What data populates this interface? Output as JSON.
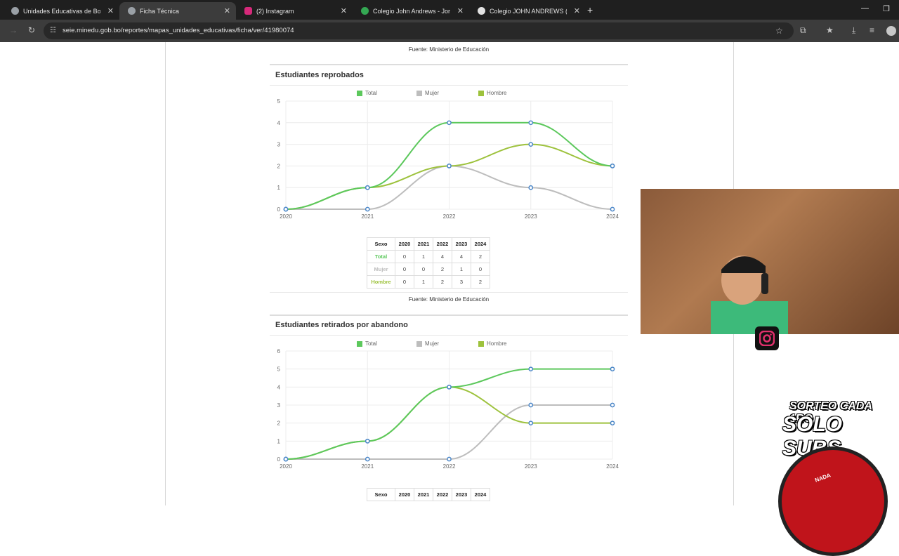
{
  "browser": {
    "tabs": [
      {
        "label": "Unidades Educativas de Bolivia",
        "icon": "globe-icon",
        "active": false
      },
      {
        "label": "Ficha Técnica",
        "icon": "globe-icon",
        "active": true
      },
      {
        "label": "(2) Instagram",
        "icon": "instagram-icon",
        "active": false
      },
      {
        "label": "Colegio John Andrews - Joroch",
        "icon": "maps-pin-icon",
        "active": false
      },
      {
        "label": "Colegio JOHN ANDREWS (@co",
        "icon": "tiktok-icon",
        "active": false
      }
    ],
    "new_tab": "+",
    "url": "seie.minedu.gob.bo/reportes/mapas_unidades_educativas/ficha/ver/41980074"
  },
  "sections": {
    "fuente_label": "Fuente: Ministerio de Educación",
    "reprobados": {
      "title": "Estudiantes reprobados",
      "legend": [
        "Total",
        "Mujer",
        "Hombre"
      ],
      "table_header": [
        "Sexo",
        "2020",
        "2021",
        "2022",
        "2023",
        "2024"
      ],
      "rows": [
        {
          "label": "Total",
          "values": [
            "0",
            "1",
            "4",
            "4",
            "2"
          ]
        },
        {
          "label": "Mujer",
          "values": [
            "0",
            "0",
            "2",
            "1",
            "0"
          ]
        },
        {
          "label": "Hombre",
          "values": [
            "0",
            "1",
            "2",
            "3",
            "2"
          ]
        }
      ]
    },
    "abandono": {
      "title": "Estudiantes retirados por abandono",
      "legend": [
        "Total",
        "Mujer",
        "Hombre"
      ],
      "table_header": [
        "Sexo",
        "2020",
        "2021",
        "2022",
        "2023",
        "2024"
      ]
    }
  },
  "overlay": {
    "promo_line1": "SORTEO CADA 1RO",
    "promo_line2": "SOLO SUBS",
    "wheel_label": "NADA"
  },
  "colors": {
    "total": "#5cc85c",
    "mujer": "#bdbdbd",
    "hombre": "#9dc23c",
    "point": "#4a86c8"
  },
  "chart_data": [
    {
      "type": "line",
      "x": [
        "2020",
        "2021",
        "2022",
        "2023",
        "2024"
      ],
      "ylim": [
        0,
        5
      ],
      "series": [
        {
          "name": "Total",
          "values": [
            0,
            1,
            4,
            4,
            2
          ]
        },
        {
          "name": "Mujer",
          "values": [
            0,
            0,
            2,
            1,
            0
          ]
        },
        {
          "name": "Hombre",
          "values": [
            0,
            1,
            2,
            3,
            2
          ]
        }
      ],
      "legend": "top"
    },
    {
      "type": "line",
      "x": [
        "2020",
        "2021",
        "2022",
        "2023",
        "2024"
      ],
      "ylim": [
        0,
        6
      ],
      "series": [
        {
          "name": "Total",
          "values": [
            0,
            1,
            4,
            5,
            5
          ]
        },
        {
          "name": "Mujer",
          "values": [
            0,
            0,
            0,
            3,
            3
          ]
        },
        {
          "name": "Hombre",
          "values": [
            0,
            1,
            4,
            2,
            2
          ]
        }
      ],
      "legend": "top"
    }
  ]
}
